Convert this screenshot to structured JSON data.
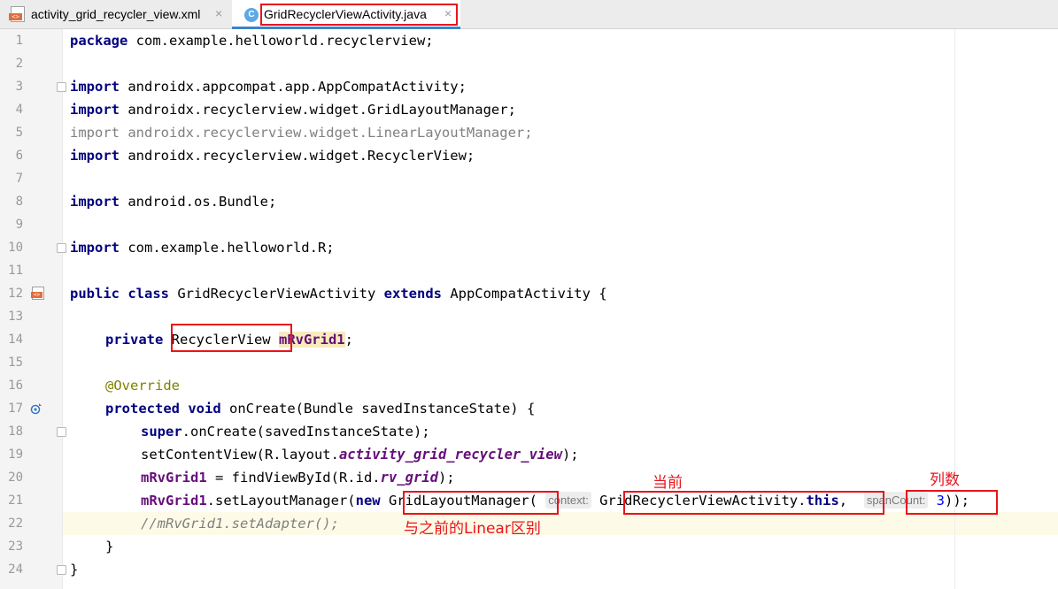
{
  "tabs": [
    {
      "label": "activity_grid_recycler_view.xml",
      "icon": "xml-file-icon",
      "active": false
    },
    {
      "label": "GridRecyclerViewActivity.java",
      "icon": "java-class-icon",
      "active": true
    }
  ],
  "close_glyph": "×",
  "class_icon_letter": "C",
  "file_badge": "<>",
  "lines": [
    {
      "n": "1"
    },
    {
      "n": "2"
    },
    {
      "n": "3"
    },
    {
      "n": "4"
    },
    {
      "n": "5"
    },
    {
      "n": "6"
    },
    {
      "n": "7"
    },
    {
      "n": "8"
    },
    {
      "n": "9"
    },
    {
      "n": "10"
    },
    {
      "n": "11"
    },
    {
      "n": "12"
    },
    {
      "n": "13"
    },
    {
      "n": "14"
    },
    {
      "n": "15"
    },
    {
      "n": "16"
    },
    {
      "n": "17"
    },
    {
      "n": "18"
    },
    {
      "n": "19"
    },
    {
      "n": "20"
    },
    {
      "n": "21"
    },
    {
      "n": "22"
    },
    {
      "n": "23"
    },
    {
      "n": "24"
    }
  ],
  "code": {
    "l1": {
      "kw": "package",
      "rest": " com.example.helloworld.recyclerview;"
    },
    "l3": {
      "kw": "import",
      "rest": " androidx.appcompat.app.AppCompatActivity;"
    },
    "l4": {
      "kw": "import",
      "rest": " androidx.recyclerview.widget.GridLayoutManager;"
    },
    "l5": {
      "text": "import androidx.recyclerview.widget.LinearLayoutManager;"
    },
    "l6": {
      "kw": "import",
      "rest": " androidx.recyclerview.widget.RecyclerView;"
    },
    "l8": {
      "kw": "import",
      "rest": " android.os.Bundle;"
    },
    "l10": {
      "kw": "import",
      "rest": " com.example.helloworld.R;"
    },
    "l12": {
      "kw1": "public",
      "kw2": "class",
      "name": " GridRecyclerViewActivity ",
      "kw3": "extends",
      "rest": " AppCompatActivity {"
    },
    "l14": {
      "kw": "private",
      "type": " RecyclerView ",
      "field": "mRvGrid1",
      "end": ";"
    },
    "l16": {
      "annotation": "@Override"
    },
    "l17": {
      "kw1": "protected",
      "kw2": "void",
      "rest": " onCreate(Bundle savedInstanceState) {"
    },
    "l18": {
      "kw": "super",
      "rest": ".onCreate(savedInstanceState);"
    },
    "l19": {
      "start": "setContentView(R.layout.",
      "field": "activity_grid_recycler_view",
      "end": ");"
    },
    "l20": {
      "field": "mRvGrid1",
      "mid": " = findViewById(R.id.",
      "field2": "rv_grid",
      "end": ");"
    },
    "l21": {
      "field": "mRvGrid1",
      "mid": ".setLayoutManager(",
      "kw": "new",
      "cls": " GridLayoutManager(",
      "hint1": "context:",
      "arg1": "GridRecyclerViewActivity.",
      "kwthis": "this",
      "comma": ", ",
      "hint2": "spanCount:",
      "num": "3",
      "end": "));"
    },
    "l22": {
      "comment": "//mRvGrid1.setAdapter();"
    },
    "l23": {
      "text": "}"
    },
    "l24": {
      "text": "}"
    }
  },
  "notes": {
    "current": "当前",
    "columns": "列数",
    "diff": "与之前的Linear区别"
  },
  "colors": {
    "annotation_red": "#e8141c",
    "keyword": "#000080",
    "field": "#660e7a"
  }
}
